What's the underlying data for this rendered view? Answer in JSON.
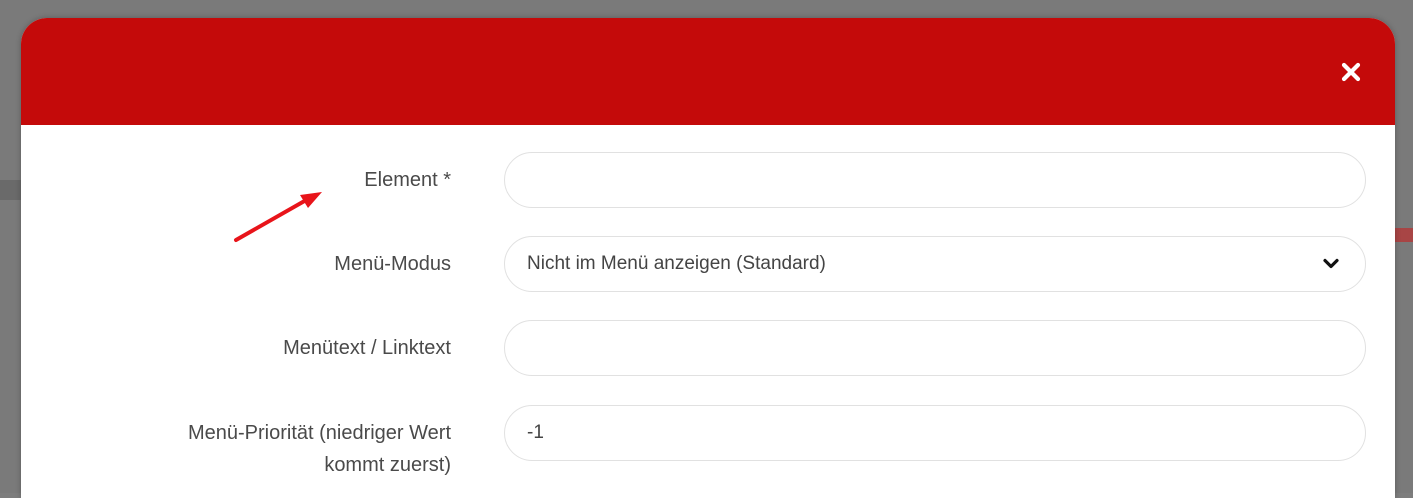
{
  "dialog": {
    "header_color": "#c40a0a",
    "close_icon": "close-icon"
  },
  "form": {
    "element": {
      "label": "Element *",
      "value": ""
    },
    "menu_mode": {
      "label": "Menü-Modus",
      "selected": "Nicht im Menü anzeigen (Standard)"
    },
    "menu_text": {
      "label": "Menütext / Linktext",
      "value": ""
    },
    "menu_priority": {
      "label_line1": "Menü-Priorität (niedriger Wert",
      "label_line2": "kommt zuerst)",
      "value": "-1"
    }
  },
  "annotation": {
    "arrow_color": "#e8141a"
  }
}
